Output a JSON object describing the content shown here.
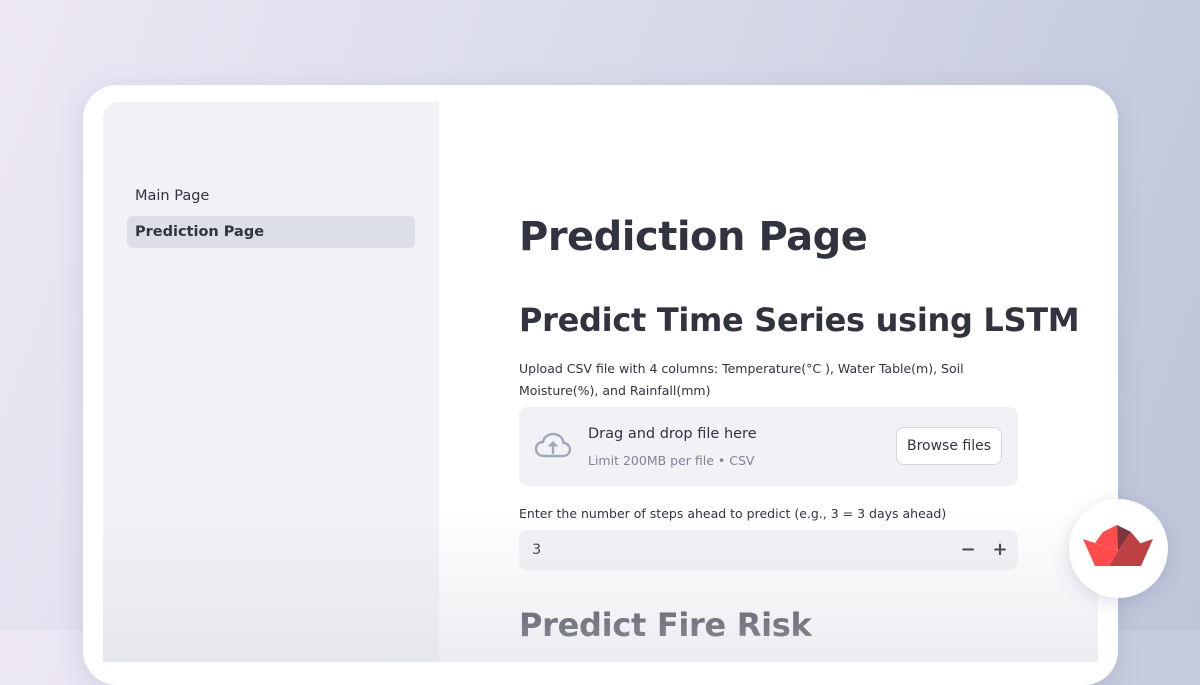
{
  "sidebar": {
    "items": [
      {
        "label": "Main Page",
        "active": false
      },
      {
        "label": "Prediction Page",
        "active": true
      }
    ]
  },
  "main": {
    "page_title": "Prediction Page",
    "sections": [
      {
        "heading": "Predict Time Series using LSTM"
      },
      {
        "heading": "Predict Fire Risk"
      }
    ],
    "uploader": {
      "label": "Upload CSV file with 4 columns: Temperature(°C ), Water Table(m), Soil Moisture(%), and Rainfall(mm)",
      "drop_title": "Drag and drop file here",
      "limit_text": "Limit 200MB per file • CSV",
      "browse_label": "Browse files",
      "icon": "cloud-upload-icon"
    },
    "steps_input": {
      "label": "Enter the number of steps ahead to predict (e.g., 3 = 3 days ahead)",
      "value": "3",
      "decrement_symbol": "−",
      "increment_symbol": "+"
    }
  },
  "badge": {
    "icon": "streamlit-logo-icon"
  },
  "colors": {
    "text": "#31333f",
    "sidebar_bg": "#f0f2f6",
    "active_item_bg": "#dcdfe8",
    "muted_text": "#808495",
    "brand_red": "#ff4b4b"
  }
}
